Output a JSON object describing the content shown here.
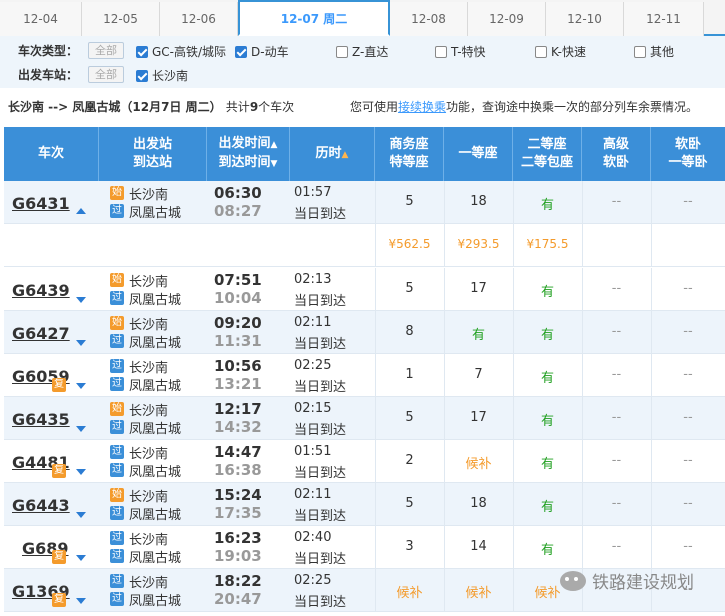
{
  "date_tabs": [
    {
      "label": "12-04",
      "active": false
    },
    {
      "label": "12-05",
      "active": false
    },
    {
      "label": "12-06",
      "active": false
    },
    {
      "label": "12-07  周二",
      "active": true
    },
    {
      "label": "12-08",
      "active": false
    },
    {
      "label": "12-09",
      "active": false
    },
    {
      "label": "12-10",
      "active": false
    },
    {
      "label": "12-11",
      "active": false
    }
  ],
  "filters": {
    "type_label": "车次类型：",
    "station_label": "出发车站：",
    "all_label": "全部",
    "types": [
      {
        "label": "GC-高铁/城际",
        "checked": true
      },
      {
        "label": "D-动车",
        "checked": true
      },
      {
        "label": "Z-直达",
        "checked": false
      },
      {
        "label": "T-特快",
        "checked": false
      },
      {
        "label": "K-快速",
        "checked": false
      },
      {
        "label": "其他",
        "checked": false
      }
    ],
    "stations": [
      {
        "label": "长沙南",
        "checked": true
      }
    ]
  },
  "summary": {
    "route": "长沙南 --> 凤凰古城（12月7日  周二）",
    "count_prefix": "共计",
    "count": "9",
    "count_suffix": "个车次",
    "note_prefix": "您可使用",
    "note_link": "接续换乘",
    "note_suffix": "功能，查询途中换乘一次的部分列车余票情况。"
  },
  "columns": {
    "train": "车次",
    "station1": "出发站",
    "station2": "到达站",
    "time1": "出发时间",
    "time2": "到达时间",
    "duration": "历时",
    "business1": "商务座",
    "business2": "特等座",
    "first": "一等座",
    "second1": "二等座",
    "second2": "二等包座",
    "hisoft1": "高级",
    "hisoft2": "软卧",
    "soft1": "软卧",
    "soft2": "一等卧"
  },
  "labels": {
    "shi": "始",
    "guo": "过",
    "fu": "复",
    "same_day": "当日到达"
  },
  "trains": [
    {
      "no": "G6431",
      "expanded": true,
      "fu": false,
      "from_type": "shi",
      "from": "长沙南",
      "to_type": "guo",
      "to": "凤凰古城",
      "dep": "06:30",
      "arr": "08:27",
      "dur": "01:57",
      "biz": "5",
      "first": "18",
      "second": "有",
      "hisoft": "--",
      "soft": "--",
      "prices": {
        "biz": "¥562.5",
        "first": "¥293.5",
        "second": "¥175.5"
      }
    },
    {
      "no": "G6439",
      "expanded": false,
      "fu": false,
      "from_type": "shi",
      "from": "长沙南",
      "to_type": "guo",
      "to": "凤凰古城",
      "dep": "07:51",
      "arr": "10:04",
      "dur": "02:13",
      "biz": "5",
      "first": "17",
      "second": "有",
      "hisoft": "--",
      "soft": "--"
    },
    {
      "no": "G6427",
      "expanded": false,
      "fu": false,
      "from_type": "shi",
      "from": "长沙南",
      "to_type": "guo",
      "to": "凤凰古城",
      "dep": "09:20",
      "arr": "11:31",
      "dur": "02:11",
      "biz": "8",
      "first": "有",
      "second": "有",
      "hisoft": "--",
      "soft": "--"
    },
    {
      "no": "G6059",
      "expanded": false,
      "fu": true,
      "from_type": "guo",
      "from": "长沙南",
      "to_type": "guo",
      "to": "凤凰古城",
      "dep": "10:56",
      "arr": "13:21",
      "dur": "02:25",
      "biz": "1",
      "first": "7",
      "second": "有",
      "hisoft": "--",
      "soft": "--"
    },
    {
      "no": "G6435",
      "expanded": false,
      "fu": false,
      "from_type": "shi",
      "from": "长沙南",
      "to_type": "guo",
      "to": "凤凰古城",
      "dep": "12:17",
      "arr": "14:32",
      "dur": "02:15",
      "biz": "5",
      "first": "17",
      "second": "有",
      "hisoft": "--",
      "soft": "--"
    },
    {
      "no": "G4481",
      "expanded": false,
      "fu": true,
      "from_type": "guo",
      "from": "长沙南",
      "to_type": "guo",
      "to": "凤凰古城",
      "dep": "14:47",
      "arr": "16:38",
      "dur": "01:51",
      "biz": "2",
      "first": "候补",
      "second": "有",
      "hisoft": "--",
      "soft": "--"
    },
    {
      "no": "G6443",
      "expanded": false,
      "fu": false,
      "from_type": "shi",
      "from": "长沙南",
      "to_type": "guo",
      "to": "凤凰古城",
      "dep": "15:24",
      "arr": "17:35",
      "dur": "02:11",
      "biz": "5",
      "first": "18",
      "second": "有",
      "hisoft": "--",
      "soft": "--"
    },
    {
      "no": "G689",
      "expanded": false,
      "fu": true,
      "from_type": "guo",
      "from": "长沙南",
      "to_type": "guo",
      "to": "凤凰古城",
      "dep": "16:23",
      "arr": "19:03",
      "dur": "02:40",
      "biz": "3",
      "first": "14",
      "second": "有",
      "hisoft": "--",
      "soft": "--"
    },
    {
      "no": "G1369",
      "expanded": false,
      "fu": true,
      "from_type": "guo",
      "from": "长沙南",
      "to_type": "guo",
      "to": "凤凰古城",
      "dep": "18:22",
      "arr": "20:47",
      "dur": "02:25",
      "biz": "候补",
      "first": "候补",
      "second": "候补",
      "hisoft": "--",
      "soft": "--"
    }
  ],
  "watermark": "铁路建设规划"
}
